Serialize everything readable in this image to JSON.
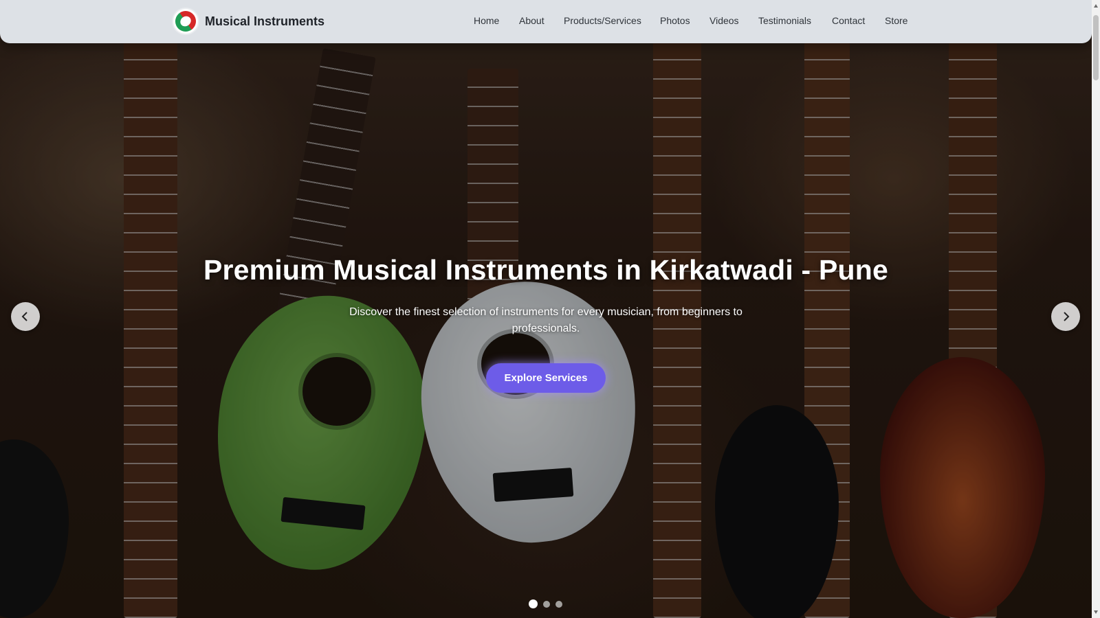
{
  "brand": {
    "name": "Musical Instruments",
    "logo_icon": "brand-logo-icon"
  },
  "nav": {
    "items": [
      {
        "label": "Home"
      },
      {
        "label": "About"
      },
      {
        "label": "Products/Services"
      },
      {
        "label": "Photos"
      },
      {
        "label": "Videos"
      },
      {
        "label": "Testimonials"
      },
      {
        "label": "Contact"
      },
      {
        "label": "Store"
      }
    ]
  },
  "hero": {
    "title": "Premium Musical Instruments in Kirkatwadi - Pune",
    "subtitle": "Discover the finest selection of instruments for every musician, from beginners to professionals.",
    "cta_label": "Explore Services",
    "prev_icon": "chevron-left-icon",
    "next_icon": "chevron-right-icon",
    "slides_total": 3,
    "active_slide": 1
  },
  "colors": {
    "navbar_bg": "#dde1e6",
    "cta_bg": "#6d5ce8",
    "text_light": "#ffffff"
  }
}
